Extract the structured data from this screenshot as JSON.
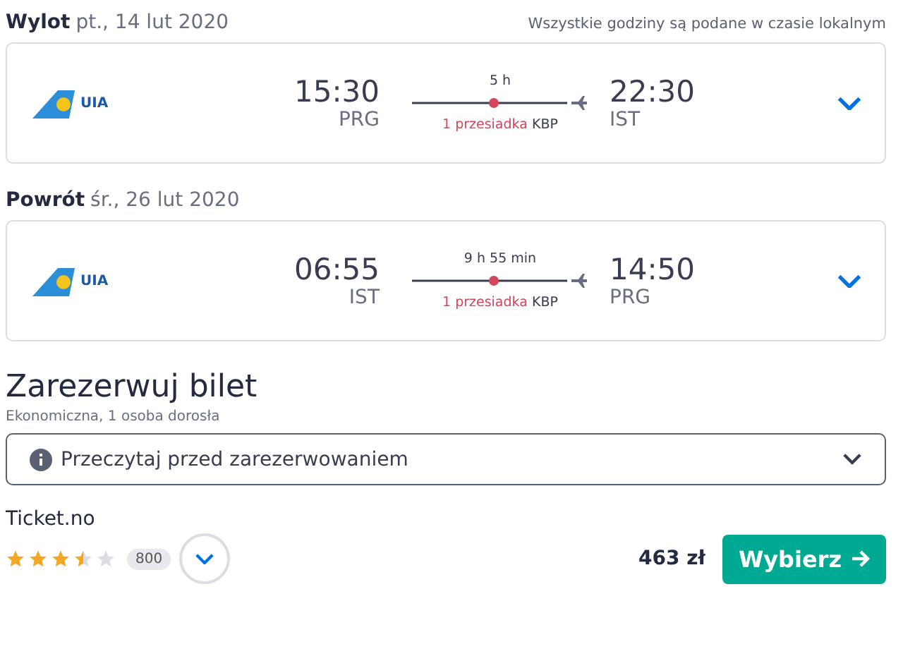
{
  "legs": [
    {
      "label": "Wylot",
      "date": "pt., 14 lut 2020",
      "note": "Wszystkie godziny są podane w czasie lokalnym",
      "airline": "UIA",
      "depart_time": "15:30",
      "depart_code": "PRG",
      "duration": "5 h",
      "stops": "1 przesiadka",
      "stop_code": "KBP",
      "arrive_time": "22:30",
      "arrive_code": "IST"
    },
    {
      "label": "Powrót",
      "date": "śr., 26 lut 2020",
      "airline": "UIA",
      "depart_time": "06:55",
      "depart_code": "IST",
      "duration": "9 h 55 min",
      "stops": "1 przesiadka",
      "stop_code": "KBP",
      "arrive_time": "14:50",
      "arrive_code": "PRG"
    }
  ],
  "booking": {
    "title": "Zarezerwuj bilet",
    "subtitle": "Ekonomiczna, 1 osoba dorosła",
    "notice": "Przeczytaj przed zarezerwowaniem",
    "provider": "Ticket.no",
    "stars": 3.5,
    "reviews": "800",
    "price": "463 zł",
    "button": "Wybierz"
  }
}
